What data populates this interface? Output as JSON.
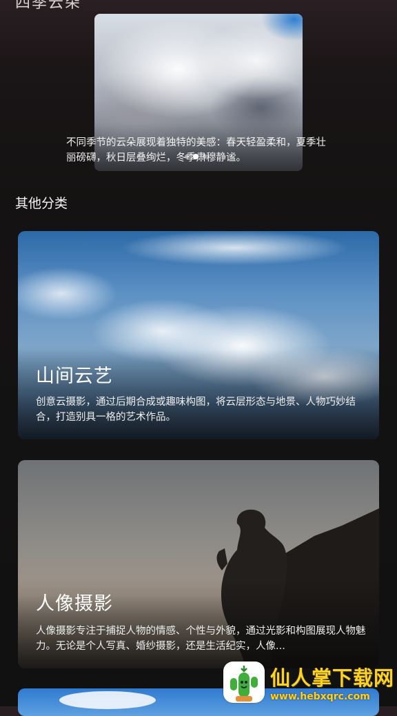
{
  "header": {
    "cut_title": "四季云朵"
  },
  "hero": {
    "description": "不同季节的云朵展现着独特的美感：春天轻盈柔和，夏季壮丽磅礴，秋日层叠绚烂，冬季肃穆静谧。",
    "pager_count": 3,
    "pager_active": 1
  },
  "section": {
    "title": "其他分类"
  },
  "cards": [
    {
      "title": "山间云艺",
      "description": "创意云摄影，通过后期合成或趣味构图，将云层形态与地景、人物巧妙结合，打造别具一格的艺术作品。"
    },
    {
      "title": "人像摄影",
      "description": "人像摄影专注于捕捉人物的情感、个性与外貌，通过光影和构图展现人物魅力。无论是个人写真、婚纱摄影，还是生活纪实，人像..."
    }
  ],
  "watermark": {
    "title": "仙人掌下载网",
    "url": "www.hebxqrc.com"
  }
}
